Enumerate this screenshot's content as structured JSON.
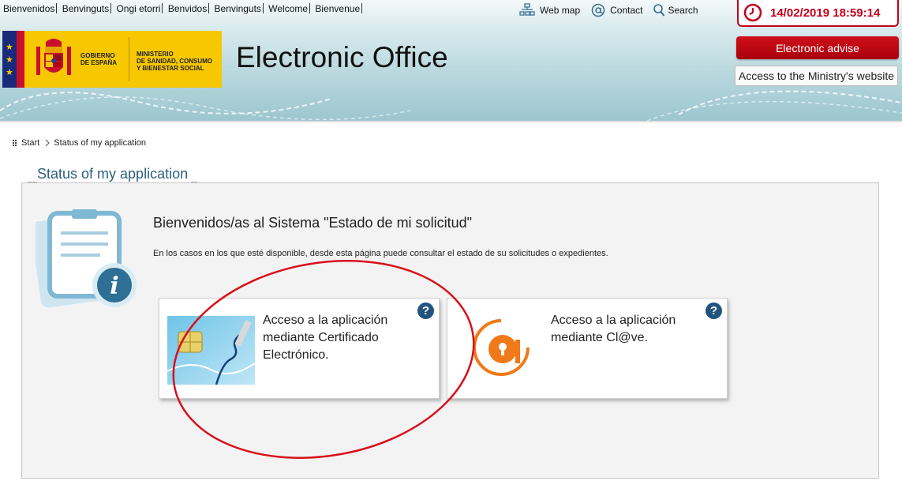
{
  "languages": [
    "Bienvenidos",
    "Benvinguts",
    "Ongi etorri",
    "Benvidos",
    "Benvinguts",
    "Welcome",
    "Bienvenue"
  ],
  "top_links": {
    "web_map": "Web map",
    "contact": "Contact",
    "search": "Search"
  },
  "logo": {
    "gov_line1": "GOBIERNO",
    "gov_line2": "DE ESPAÑA",
    "min_line1": "MINISTERIO",
    "min_line2": "DE SANIDAD, CONSUMO",
    "min_line3": "Y BIENESTAR SOCIAL"
  },
  "app_title": "Electronic Office",
  "clock": {
    "datetime": "14/02/2019 18:59:14"
  },
  "buttons": {
    "electronic_advise": "Electronic advise",
    "ministry_website": "Access to the Ministry's website"
  },
  "breadcrumb": {
    "start": "Start",
    "current": "Status of my application"
  },
  "section_title": "Status of my application",
  "welcome": "Bienvenidos/as al Sistema \"Estado de mi solicitud\"",
  "info": "En los casos en los que esté disponible, desde esta página puede consultar el estado de su solicitudes o expedientes.",
  "cards": [
    {
      "line1": "Acceso a la aplicación",
      "line2": "mediante Certificado",
      "line3": "Electrónico.",
      "help": "?"
    },
    {
      "line1": "Acceso a la aplicación",
      "line2": "mediante Cl@ve.",
      "line3": "",
      "help": "?"
    }
  ],
  "colors": {
    "accent_red": "#c4001a",
    "title_blue": "#2e5f80",
    "help_blue": "#22557f",
    "clave_orange": "#f07a18"
  }
}
